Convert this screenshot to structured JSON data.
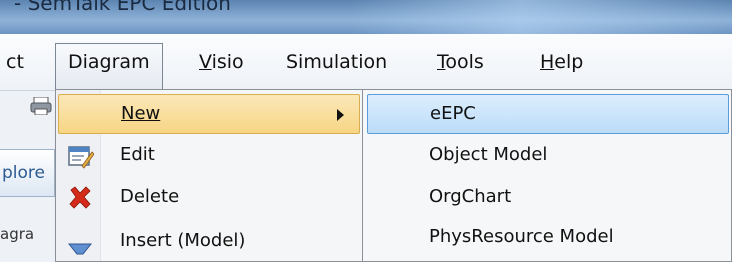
{
  "window": {
    "title": "- SemTalk EPC Edition"
  },
  "menubar": {
    "items": [
      {
        "label": "ct",
        "underline": ""
      },
      {
        "label": "Diagram",
        "underline": ""
      },
      {
        "label": "Visio",
        "underline": "V"
      },
      {
        "label": "Simulation",
        "underline": ""
      },
      {
        "label": "Tools",
        "underline": "T"
      },
      {
        "label": "Help",
        "underline": "H"
      }
    ]
  },
  "left_pane": {
    "tab_label": "plore",
    "fragment": "agra"
  },
  "diagram_menu": {
    "items": [
      {
        "label": "New",
        "icon": "none",
        "has_submenu": true,
        "highlighted": true
      },
      {
        "label": "Edit",
        "icon": "edit-window-icon"
      },
      {
        "label": "Delete",
        "icon": "red-x-delete-icon"
      },
      {
        "label": "Insert (Model)",
        "icon": "funnel-insert-icon"
      }
    ]
  },
  "new_submenu": {
    "items": [
      {
        "label": "eEPC",
        "highlighted": true
      },
      {
        "label": "Object Model"
      },
      {
        "label": "OrgChart"
      },
      {
        "label": "PhysResource Model"
      }
    ]
  },
  "colors": {
    "titlebar": "#6c94c2",
    "menu_highlight": "#f7d584",
    "submenu_highlight": "#bcdcf8",
    "delete_red": "#d42a1a"
  }
}
